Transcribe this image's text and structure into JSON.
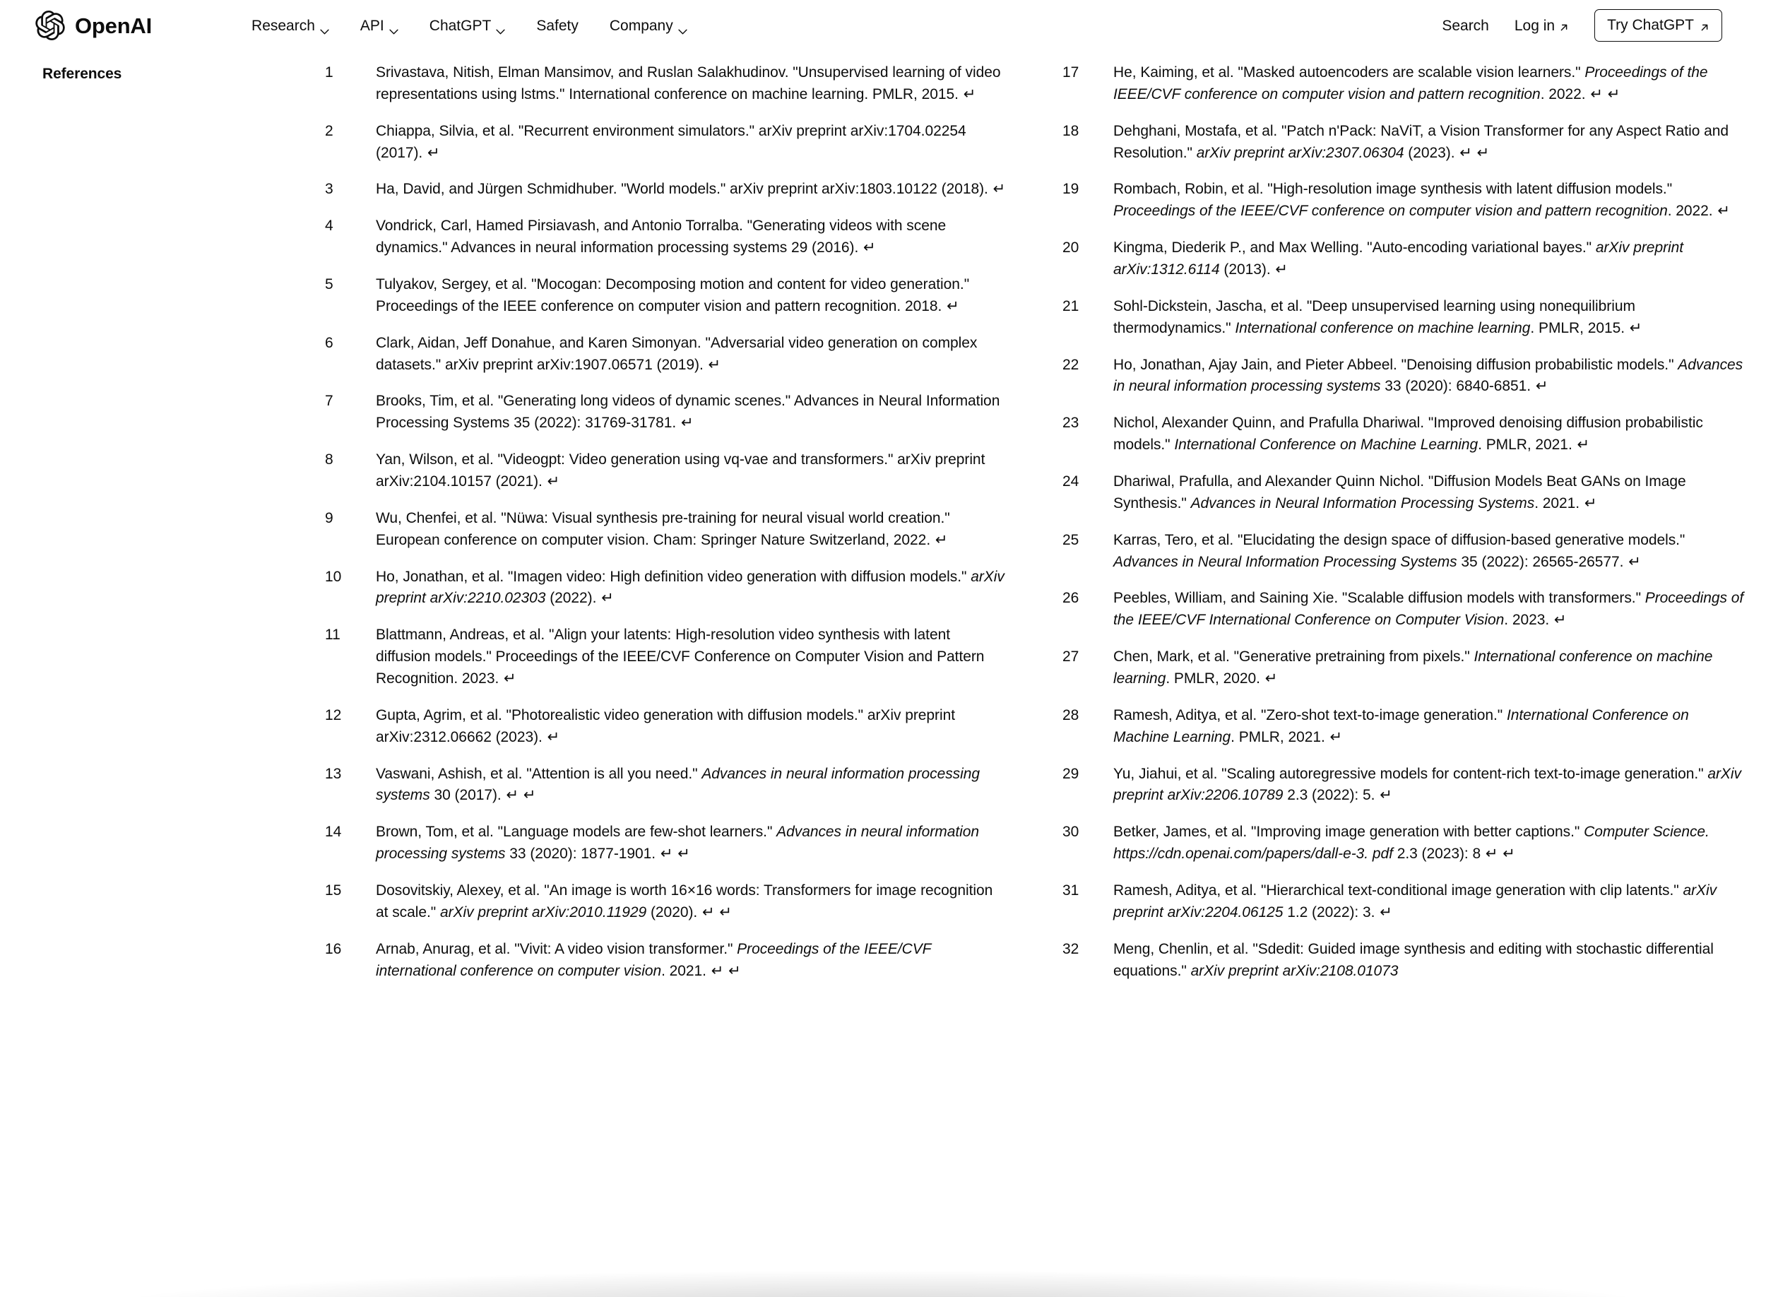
{
  "header": {
    "brand_name": "OpenAI",
    "logo_icon": "openai-logo",
    "nav_items": [
      {
        "label": "Research",
        "has_caret": true,
        "caret_icon": "chevron-down-icon"
      },
      {
        "label": "API",
        "has_caret": true,
        "caret_icon": "chevron-down-icon"
      },
      {
        "label": "ChatGPT",
        "has_caret": true,
        "caret_icon": "chevron-down-icon"
      },
      {
        "label": "Safety",
        "has_caret": false,
        "caret_icon": ""
      },
      {
        "label": "Company",
        "has_caret": true,
        "caret_icon": "chevron-down-icon"
      }
    ],
    "search_label": "Search",
    "search_icon": "search-icon",
    "login_label": "Log in",
    "login_icon": "arrow-up-right-icon",
    "cta_label": "Try ChatGPT",
    "cta_icon": "arrow-up-right-icon"
  },
  "references": {
    "heading": "References",
    "return_glyph": "↵",
    "left_column": [
      {
        "num": "1",
        "html": "Srivastava, Nitish, Elman Mansimov, and Ruslan Salakhudinov. \"Unsupervised learning of video representations using lstms.\" International conference on machine learning. PMLR, 2015. <span class=\"pilcrow\">↵</span>"
      },
      {
        "num": "2",
        "html": "Chiappa, Silvia, et al. \"Recurrent environment simulators.\" arXiv preprint arXiv:1704.02254 (2017). <span class=\"pilcrow\">↵</span>"
      },
      {
        "num": "3",
        "html": "Ha, David, and Jürgen Schmidhuber. \"World models.\" arXiv preprint arXiv:1803.10122 (2018). <span class=\"pilcrow\">↵</span>"
      },
      {
        "num": "4",
        "html": "Vondrick, Carl, Hamed Pirsiavash, and Antonio Torralba. \"Generating videos with scene dynamics.\" Advances in neural information processing systems 29 (2016). <span class=\"pilcrow\">↵</span>"
      },
      {
        "num": "5",
        "html": "Tulyakov, Sergey, et al. \"Mocogan: Decomposing motion and content for video generation.\" Proceedings of the IEEE conference on computer vision and pattern recognition. 2018. <span class=\"pilcrow\">↵</span>"
      },
      {
        "num": "6",
        "html": "Clark, Aidan, Jeff Donahue, and Karen Simonyan. \"Adversarial video generation on complex datasets.\" arXiv preprint arXiv:1907.06571 (2019). <span class=\"pilcrow\">↵</span>"
      },
      {
        "num": "7",
        "html": "Brooks, Tim, et al. \"Generating long videos of dynamic scenes.\" Advances in Neural Information Processing Systems 35 (2022): 31769-31781. <span class=\"pilcrow\">↵</span>"
      },
      {
        "num": "8",
        "html": "Yan, Wilson, et al. \"Videogpt: Video generation using vq-vae and transformers.\" arXiv preprint arXiv:2104.10157 (2021). <span class=\"pilcrow\">↵</span>"
      },
      {
        "num": "9",
        "html": "Wu, Chenfei, et al. \"Nüwa: Visual synthesis pre-training for neural visual world creation.\" European conference on computer vision. Cham: Springer Nature Switzerland, 2022. <span class=\"pilcrow\">↵</span>"
      },
      {
        "num": "10",
        "html": "Ho, Jonathan, et al. \"Imagen video: High definition video generation with diffusion models.\" <i>arXiv preprint arXiv:2210.02303</i> (2022). <span class=\"pilcrow\">↵</span>"
      },
      {
        "num": "11",
        "html": "Blattmann, Andreas, et al. \"Align your latents: High-resolution video synthesis with latent diffusion models.\" Proceedings of the IEEE/CVF Conference on Computer Vision and Pattern Recognition. 2023. <span class=\"pilcrow\">↵</span>"
      },
      {
        "num": "12",
        "html": "Gupta, Agrim, et al. \"Photorealistic video generation with diffusion models.\" arXiv preprint arXiv:2312.06662 (2023). <span class=\"pilcrow\">↵</span>"
      },
      {
        "num": "13",
        "html": "Vaswani, Ashish, et al. \"Attention is all you need.\" <i>Advances in neural information processing systems</i> 30 (2017). <span class=\"pilcrow\">↵</span> <span class=\"pilcrow\">↵</span>"
      },
      {
        "num": "14",
        "html": "Brown, Tom, et al. \"Language models are few-shot learners.\" <i>Advances in neural information processing systems</i> 33 (2020): 1877-1901. <span class=\"pilcrow\">↵</span> <span class=\"pilcrow\">↵</span>"
      },
      {
        "num": "15",
        "html": "Dosovitskiy, Alexey, et al. \"An image is worth 16×16 words: Transformers for image recognition at scale.\" <i>arXiv preprint arXiv:2010.11929</i> (2020). <span class=\"pilcrow\">↵</span> <span class=\"pilcrow\">↵</span>"
      },
      {
        "num": "16",
        "html": "Arnab, Anurag, et al. \"Vivit: A video vision transformer.\" <i>Proceedings of the IEEE/CVF international conference on computer vision</i>. 2021. <span class=\"pilcrow\">↵</span> <span class=\"pilcrow\">↵</span>"
      }
    ],
    "right_column": [
      {
        "num": "17",
        "html": "He, Kaiming, et al. \"Masked autoencoders are scalable vision learners.\" <i>Proceedings of the IEEE/CVF conference on computer vision and pattern recognition</i>. 2022. <span class=\"pilcrow\">↵</span> <span class=\"pilcrow\">↵</span>"
      },
      {
        "num": "18",
        "html": "Dehghani, Mostafa, et al. \"Patch n'Pack: NaViT, a Vision Transformer for any Aspect Ratio and Resolution.\" <i>arXiv preprint arXiv:2307.06304</i> (2023). <span class=\"pilcrow\">↵</span> <span class=\"pilcrow\">↵</span>"
      },
      {
        "num": "19",
        "html": "Rombach, Robin, et al. \"High-resolution image synthesis with latent diffusion models.\" <i>Proceedings of the IEEE/CVF conference on computer vision and pattern recognition</i>. 2022. <span class=\"pilcrow\">↵</span>"
      },
      {
        "num": "20",
        "html": "Kingma, Diederik P., and Max Welling. \"Auto-encoding variational bayes.\" <i>arXiv preprint arXiv:1312.6114</i> (2013). <span class=\"pilcrow\">↵</span>"
      },
      {
        "num": "21",
        "html": "Sohl-Dickstein, Jascha, et al. \"Deep unsupervised learning using nonequilibrium thermodynamics.\" <i>International conference on machine learning</i>. PMLR, 2015. <span class=\"pilcrow\">↵</span>"
      },
      {
        "num": "22",
        "html": "Ho, Jonathan, Ajay Jain, and Pieter Abbeel. \"Denoising diffusion probabilistic models.\" <i>Advances in neural information processing systems</i> 33 (2020): 6840-6851. <span class=\"pilcrow\">↵</span>"
      },
      {
        "num": "23",
        "html": "Nichol, Alexander Quinn, and Prafulla Dhariwal. \"Improved denoising diffusion probabilistic models.\" <i>International Conference on Machine Learning</i>. PMLR, 2021. <span class=\"pilcrow\">↵</span>"
      },
      {
        "num": "24",
        "html": "Dhariwal, Prafulla, and Alexander Quinn Nichol. \"Diffusion Models Beat GANs on Image Synthesis.\" <i>Advances in Neural Information Processing Systems</i>. 2021. <span class=\"pilcrow\">↵</span>"
      },
      {
        "num": "25",
        "html": "Karras, Tero, et al. \"Elucidating the design space of diffusion-based generative models.\" <i>Advances in Neural Information Processing Systems</i> 35 (2022): 26565-26577. <span class=\"pilcrow\">↵</span>"
      },
      {
        "num": "26",
        "html": "Peebles, William, and Saining Xie. \"Scalable diffusion models with transformers.\" <i>Proceedings of the IEEE/CVF International Conference on Computer Vision</i>. 2023. <span class=\"pilcrow\">↵</span>"
      },
      {
        "num": "27",
        "html": "Chen, Mark, et al. \"Generative pretraining from pixels.\" <i>International conference on machine learning</i>. PMLR, 2020. <span class=\"pilcrow\">↵</span>"
      },
      {
        "num": "28",
        "html": "Ramesh, Aditya, et al. \"Zero-shot text-to-image generation.\" <i>International Conference on Machine Learning</i>. PMLR, 2021. <span class=\"pilcrow\">↵</span>"
      },
      {
        "num": "29",
        "html": "Yu, Jiahui, et al. \"Scaling autoregressive models for content-rich text-to-image generation.\" <i>arXiv preprint arXiv:2206.10789</i> 2.3 (2022): 5. <span class=\"pilcrow\">↵</span>"
      },
      {
        "num": "30",
        "html": "Betker, James, et al. \"Improving image generation with better captions.\" <i>Computer Science. https://cdn.openai.com/papers/dall-e-3. pdf</i> 2.3 (2023): 8 <span class=\"pilcrow\">↵</span> <span class=\"pilcrow\">↵</span>"
      },
      {
        "num": "31",
        "html": "Ramesh, Aditya, et al. \"Hierarchical text-conditional image generation with clip latents.\" <i>arXiv preprint arXiv:2204.06125</i> 1.2 (2022): 3. <span class=\"pilcrow\">↵</span>"
      },
      {
        "num": "32",
        "html": "Meng, Chenlin, et al. \"Sdedit: Guided image synthesis and editing with stochastic differential equations.\" <i>arXiv preprint arXiv:2108.01073</i>"
      }
    ]
  },
  "colors": {
    "text": "#0d0d0d",
    "background": "#ffffff",
    "border": "#0d0d0d"
  }
}
